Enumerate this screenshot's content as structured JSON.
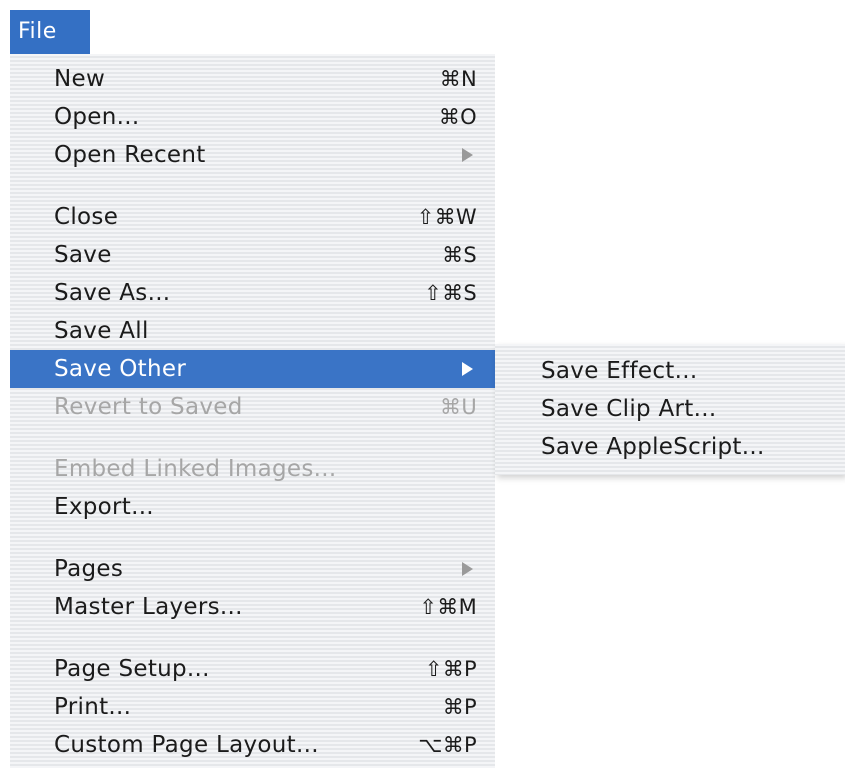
{
  "menu_title": "File",
  "menu": {
    "items": [
      {
        "label": "New",
        "shortcut": "⌘N"
      },
      {
        "label": "Open...",
        "shortcut": "⌘O"
      },
      {
        "label": "Open Recent",
        "submenu": true
      },
      {
        "label": "Close",
        "shortcut": "⇧⌘W"
      },
      {
        "label": "Save",
        "shortcut": "⌘S"
      },
      {
        "label": "Save As...",
        "shortcut": "⇧⌘S"
      },
      {
        "label": "Save All"
      },
      {
        "label": "Save Other",
        "submenu": true,
        "selected": true
      },
      {
        "label": "Revert to Saved",
        "shortcut": "⌘U",
        "disabled": true
      },
      {
        "label": "Embed Linked Images...",
        "disabled": true
      },
      {
        "label": "Export..."
      },
      {
        "label": "Pages",
        "submenu": true
      },
      {
        "label": "Master Layers...",
        "shortcut": "⇧⌘M"
      },
      {
        "label": "Page Setup...",
        "shortcut": "⇧⌘P"
      },
      {
        "label": "Print...",
        "shortcut": "⌘P"
      },
      {
        "label": "Custom Page Layout...",
        "shortcut": "⌥⌘P"
      }
    ]
  },
  "submenu": {
    "items": [
      {
        "label": "Save Effect..."
      },
      {
        "label": "Save Clip Art..."
      },
      {
        "label": "Save AppleScript..."
      }
    ]
  },
  "colors": {
    "selection": "#3a74c6",
    "title_highlight": "#3470c4",
    "disabled_text": "#a6a6a6"
  }
}
